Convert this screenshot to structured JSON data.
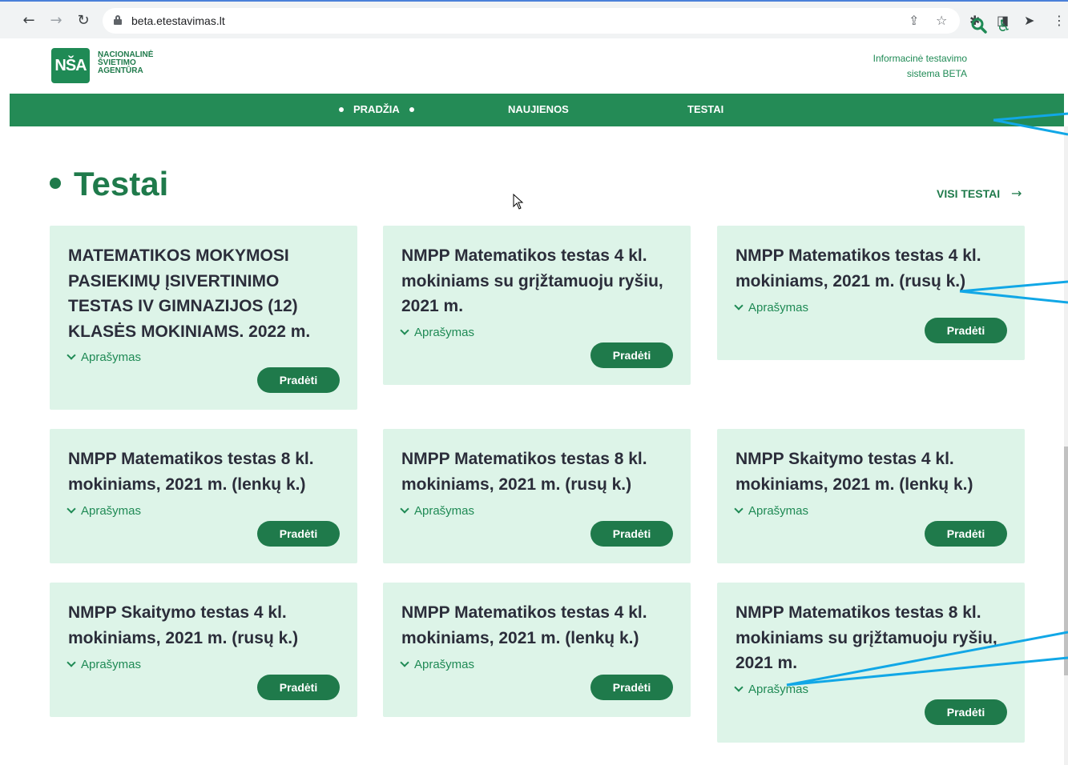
{
  "browser": {
    "url": "beta.etestavimas.lt"
  },
  "header": {
    "logo_mark": "NŠA",
    "logo_lines": [
      "NACIONALINĖ",
      "ŠVIETIMO",
      "AGENTŪRA"
    ],
    "system_name_line1": "Informacinė testavimo",
    "system_name_line2": "sistema BETA"
  },
  "nav": {
    "items": [
      {
        "label": "PRADŽIA",
        "active": true
      },
      {
        "label": "NAUJIENOS",
        "active": false
      },
      {
        "label": "TESTAI",
        "active": false
      }
    ]
  },
  "section": {
    "title": "Testai",
    "all_link": "VISI TESTAI"
  },
  "cards": [
    {
      "title": "MATEMATIKOS MOKYMOSI PASIEKIMŲ ĮSIVERTINIMO TESTAS IV GIMNAZIJOS (12) KLASĖS MOKINIAMS. 2022 m.",
      "desc": "Aprašymas",
      "button": "Pradėti"
    },
    {
      "title": "NMPP Matematikos testas 4 kl. mokiniams su grįžtamuoju ryšiu, 2021 m.",
      "desc": "Aprašymas",
      "button": "Pradėti"
    },
    {
      "title": "NMPP Matematikos testas 4 kl. mokiniams, 2021 m. (rusų k.)",
      "desc": "Aprašymas",
      "button": "Pradėti"
    },
    {
      "title": "NMPP Matematikos testas 8 kl. mokiniams, 2021 m. (lenkų k.)",
      "desc": "Aprašymas",
      "button": "Pradėti"
    },
    {
      "title": "NMPP Matematikos testas 8 kl. mokiniams, 2021 m. (rusų k.)",
      "desc": "Aprašymas",
      "button": "Pradėti"
    },
    {
      "title": "NMPP Skaitymo testas 4 kl. mokiniams, 2021 m. (lenkų k.)",
      "desc": "Aprašymas",
      "button": "Pradėti"
    },
    {
      "title": "NMPP Skaitymo testas 4 kl. mokiniams, 2021 m. (rusų k.)",
      "desc": "Aprašymas",
      "button": "Pradėti"
    },
    {
      "title": "NMPP Matematikos testas 4 kl. mokiniams, 2021 m. (lenkų k.)",
      "desc": "Aprašymas",
      "button": "Pradėti"
    },
    {
      "title": "NMPP Matematikos testas 8 kl. mokiniams su grįžtamuoju ryšiu, 2021 m.",
      "desc": "Aprašymas",
      "button": "Pradėti"
    }
  ],
  "colors": {
    "brand_green": "#248b56",
    "card_bg": "#ddf4e8",
    "annotation_blue": "#11a7e6"
  }
}
